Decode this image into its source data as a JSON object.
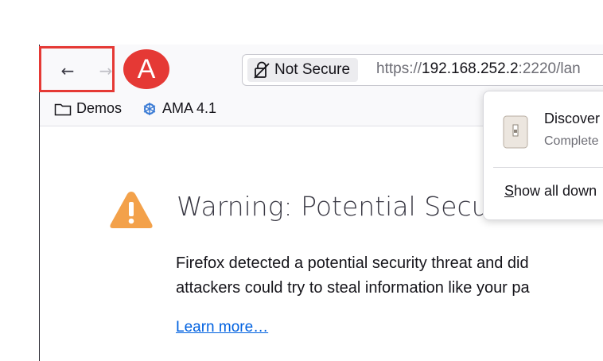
{
  "toolbar": {
    "back_arrow": "←",
    "forward_arrow": "→",
    "annotation_label": "A"
  },
  "urlbar": {
    "security_label": "Not Secure",
    "url_scheme": "https://",
    "url_host": "192.168.252.2",
    "url_rest": ":2220/lan"
  },
  "bookmarks": [
    {
      "label": "Demos",
      "icon": "folder-icon"
    },
    {
      "label": "AMA 4.1",
      "icon": "ama-logo-icon"
    }
  ],
  "page": {
    "title": "Warning: Potential Secu",
    "paragraph_line1": "Firefox detected a potential security threat and did",
    "paragraph_line2": "attackers could try to steal information like your pa",
    "learn_more": "Learn more…"
  },
  "downloads_panel": {
    "item_name": "Discover",
    "item_status": "Complete",
    "show_all_underlined": "S",
    "show_all_rest": "how all down"
  },
  "colors": {
    "annotation_red": "#e53935",
    "warning_orange": "#f3a14a",
    "link_blue": "#0061e0"
  }
}
